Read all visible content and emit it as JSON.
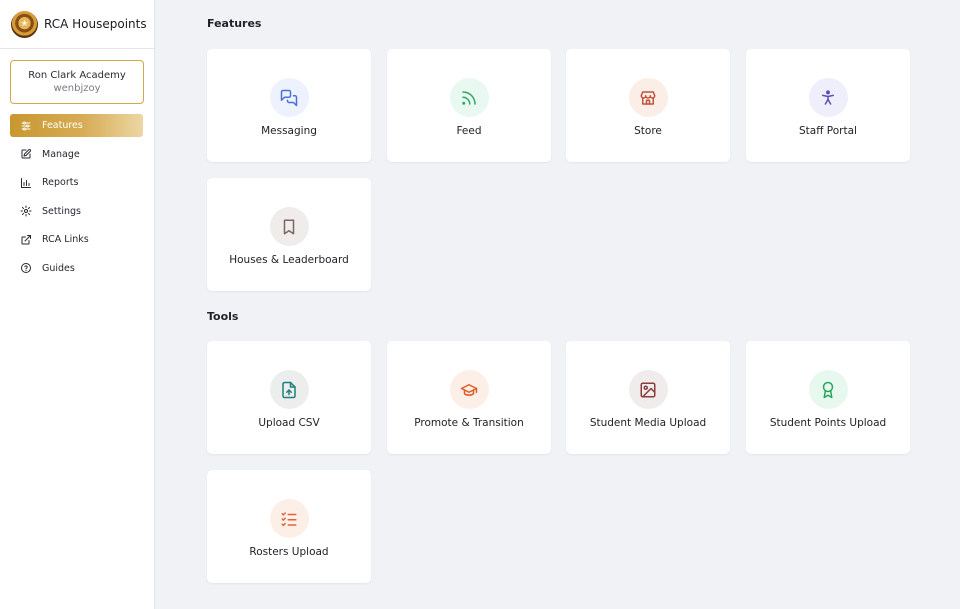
{
  "app": {
    "title": "RCA Housepoints"
  },
  "account": {
    "school": "Ron Clark Academy",
    "username": "wenbjzoy"
  },
  "sidebar": {
    "items": [
      {
        "label": "Features",
        "icon": "sliders-icon",
        "active": true
      },
      {
        "label": "Manage",
        "icon": "edit-icon",
        "active": false
      },
      {
        "label": "Reports",
        "icon": "bar-chart-icon",
        "active": false
      },
      {
        "label": "Settings",
        "icon": "gear-icon",
        "active": false
      },
      {
        "label": "RCA Links",
        "icon": "external-link-icon",
        "active": false
      },
      {
        "label": "Guides",
        "icon": "help-circle-icon",
        "active": false
      }
    ]
  },
  "features": {
    "title": "Features",
    "cards": [
      {
        "label": "Messaging",
        "icon": "messages-icon",
        "bg": "#eef2ff",
        "color": "#4b6fd6"
      },
      {
        "label": "Feed",
        "icon": "rss-icon",
        "bg": "#e9f8f0",
        "color": "#2fa866"
      },
      {
        "label": "Store",
        "icon": "store-icon",
        "bg": "#faeee6",
        "color": "#c0533c"
      },
      {
        "label": "Staff Portal",
        "icon": "accessibility-icon",
        "bg": "#efeefb",
        "color": "#5a4db8"
      },
      {
        "label": "Houses & Leaderboard",
        "icon": "bookmark-icon",
        "bg": "#efeceb",
        "color": "#7d6660"
      }
    ]
  },
  "tools": {
    "title": "Tools",
    "cards": [
      {
        "label": "Upload CSV",
        "icon": "file-upload-icon",
        "bg": "#eceeee",
        "color": "#1f7f7a"
      },
      {
        "label": "Promote & Transition",
        "icon": "graduation-cap-icon",
        "bg": "#fcefe8",
        "color": "#e05a26"
      },
      {
        "label": "Student Media Upload",
        "icon": "image-icon",
        "bg": "#f1ecec",
        "color": "#8b3b3b"
      },
      {
        "label": "Student Points Upload",
        "icon": "award-icon",
        "bg": "#e7f8ee",
        "color": "#2aa55e"
      },
      {
        "label": "Rosters Upload",
        "icon": "list-checks-icon",
        "bg": "#fcefe8",
        "color": "#e0643a"
      }
    ]
  }
}
